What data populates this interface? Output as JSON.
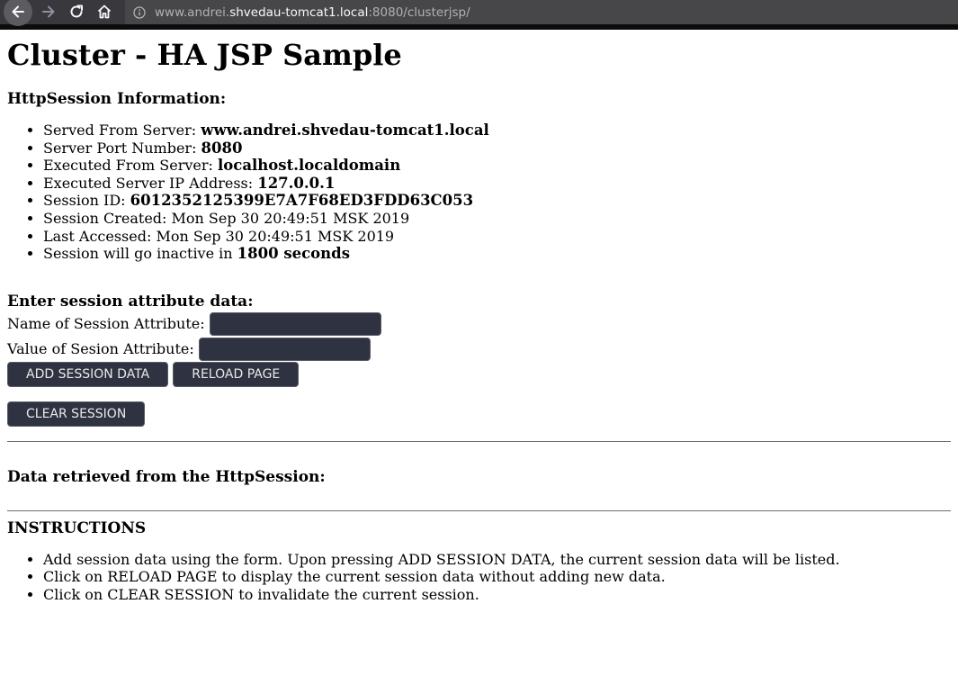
{
  "browser": {
    "url_prefix": "www.andrei.",
    "url_host": "shvedau-tomcat1.local",
    "url_suffix": ":8080/clusterjsp/",
    "icons": [
      "arrow-left-icon",
      "arrow-right-icon",
      "reload-icon",
      "home-icon",
      "info-icon"
    ]
  },
  "page": {
    "title": "Cluster - HA JSP Sample",
    "session_heading": "HttpSession Information:",
    "session_info": [
      {
        "label": "Served From Server: ",
        "value": "www.andrei.shvedau-tomcat1.local"
      },
      {
        "label": "Server Port Number: ",
        "value": "8080"
      },
      {
        "label": "Executed From Server: ",
        "value": "localhost.localdomain"
      },
      {
        "label": "Executed Server IP Address: ",
        "value": "127.0.0.1"
      },
      {
        "label": "Session ID: ",
        "value": "6012352125399E7A7F68ED3FDD63C053"
      },
      {
        "label": "Session Created: Mon Sep 30 20:49:51 MSK 2019",
        "value": ""
      },
      {
        "label": "Last Accessed: Mon Sep 30 20:49:51 MSK 2019",
        "value": ""
      },
      {
        "label": "Session will go inactive in ",
        "value": "1800 seconds"
      }
    ],
    "form": {
      "heading": "Enter session attribute data:",
      "name_label": "Name of Session Attribute:",
      "value_label": "Value of Sesion Attribute:",
      "name_value": "",
      "value_value": "",
      "add_button": "ADD SESSION DATA",
      "reload_button": "RELOAD PAGE",
      "clear_button": "CLEAR SESSION"
    },
    "retrieved_heading": "Data retrieved from the HttpSession:",
    "instructions_heading": "INSTRUCTIONS",
    "instructions": [
      "Add session data using the form. Upon pressing ADD SESSION DATA, the current session data will be listed.",
      "Click on RELOAD PAGE to display the current session data without adding new data.",
      "Click on CLEAR SESSION to invalidate the current session."
    ]
  },
  "colors": {
    "toolbar_bg": "#38383d",
    "urlbar_bg": "#474749",
    "button_bg": "#2f3240",
    "button_text": "#e9e9ea"
  }
}
